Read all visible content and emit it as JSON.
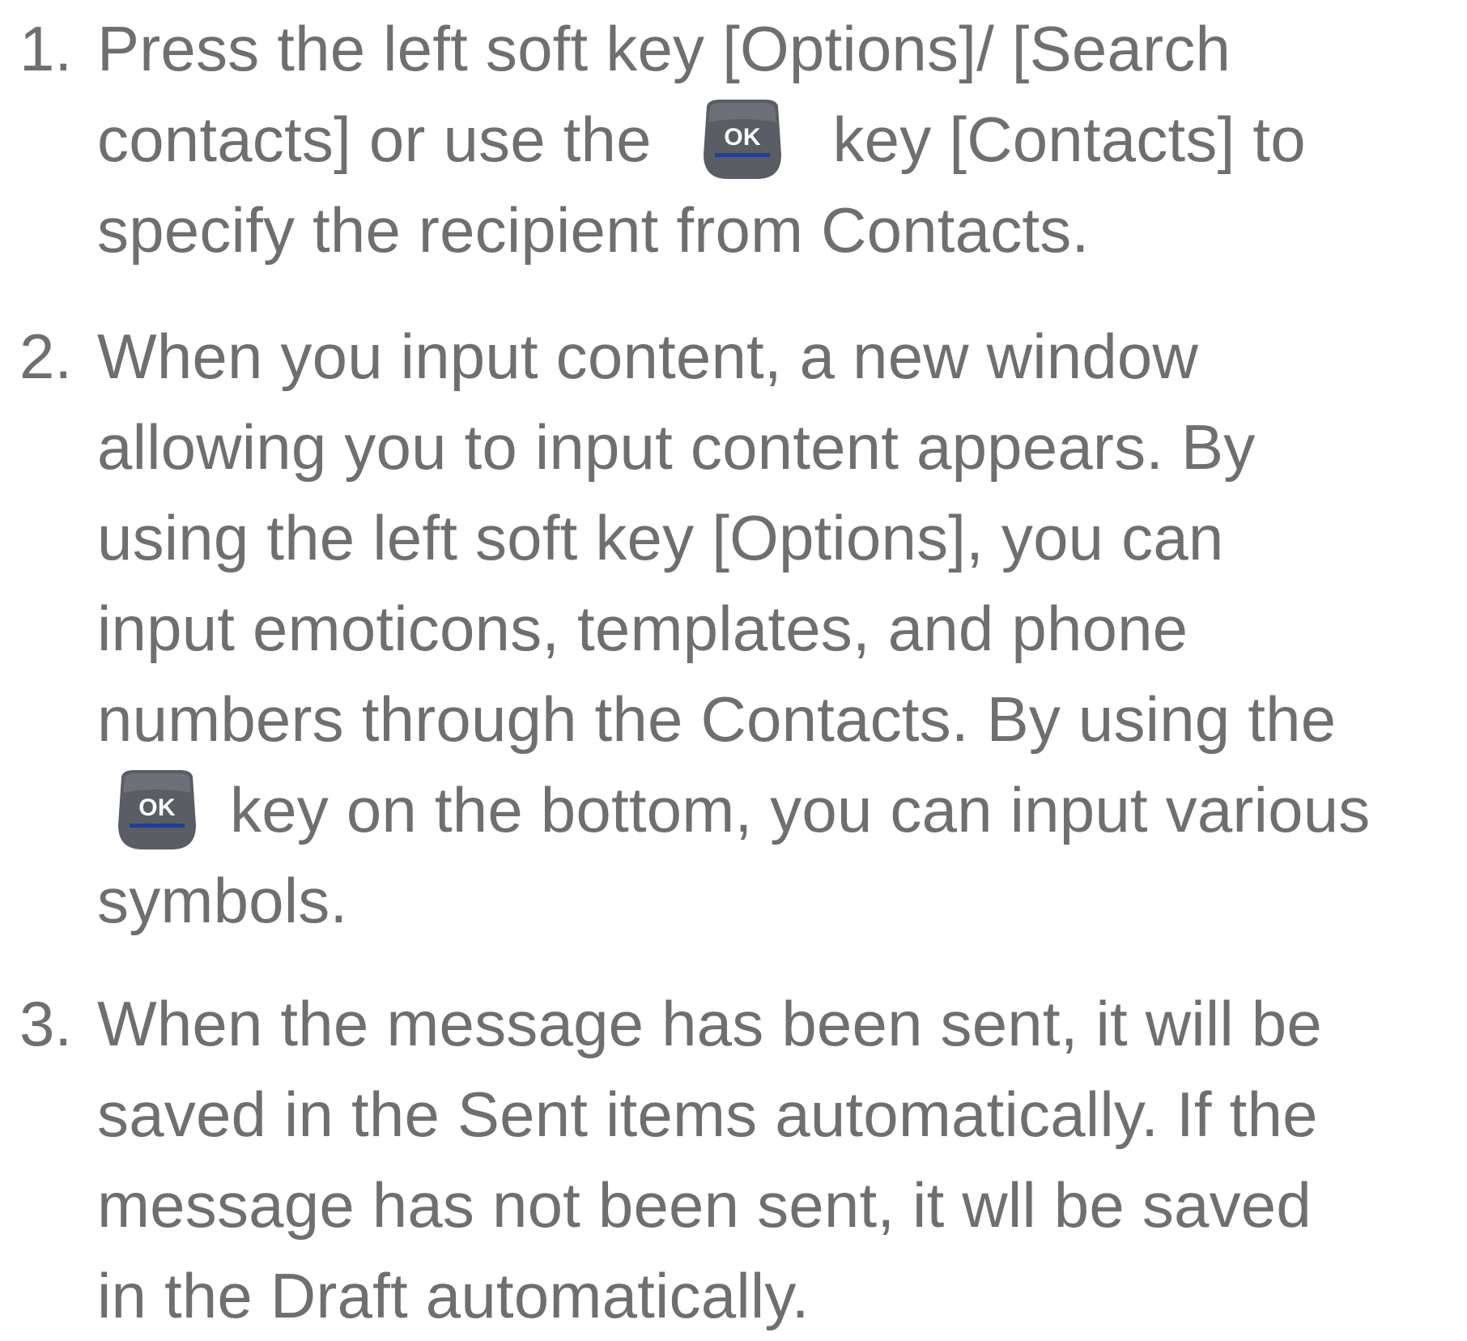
{
  "steps": [
    {
      "number": "1.",
      "lines": [
        "Press the left soft key [Options]/ [Search",
        {
          "before": "contacts] or use the",
          "icon": "ok-key-icon",
          "after": "key [Contacts] to"
        },
        "specify the recipient from Contacts."
      ]
    },
    {
      "number": "2.",
      "lines": [
        "When you input content, a new window",
        "allowing you to input content appears. By",
        "using the left soft key [Options], you can",
        "input emoticons, templates, and phone",
        "numbers through the Contacts. By using the",
        {
          "before": "",
          "icon": "ok-key-icon",
          "after": "key on the bottom, you can input various"
        },
        "symbols."
      ]
    },
    {
      "number": "3.",
      "lines": [
        "When the message has been sent, it will be",
        "saved in the Sent items automatically. If the",
        "message has not been sent, it wll be saved",
        "in the Draft automatically."
      ]
    }
  ],
  "icons": {
    "ok_key_label": "OK",
    "ok_key_color": "#5a5d63",
    "ok_key_underline": "#1f3f9a"
  }
}
